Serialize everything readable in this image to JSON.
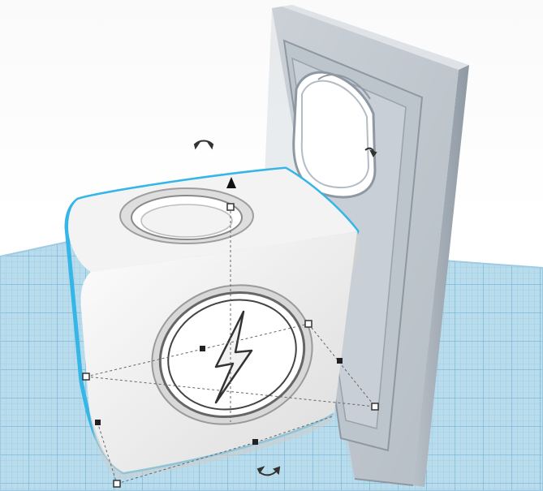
{
  "app": {
    "view": "3d-workplane",
    "selected_object": "cube-charger-box"
  },
  "colors": {
    "background": "#ffffff",
    "workplane": "#a9d3ea",
    "grid_line": "#7fb7d8",
    "selection_outline": "#35b6e6",
    "object_face": "#ececec",
    "object_shadow": "#b9b9b9",
    "handle_fill": "#ffffff",
    "handle_stroke": "#333333"
  },
  "icons": {
    "rotate_top": "rotate-arrow-icon",
    "rotate_side": "rotate-arrow-icon",
    "rotate_bottom": "rotate-arrow-icon",
    "height_arrow": "height-arrow-icon",
    "lightning": "lightning-bolt-icon"
  }
}
